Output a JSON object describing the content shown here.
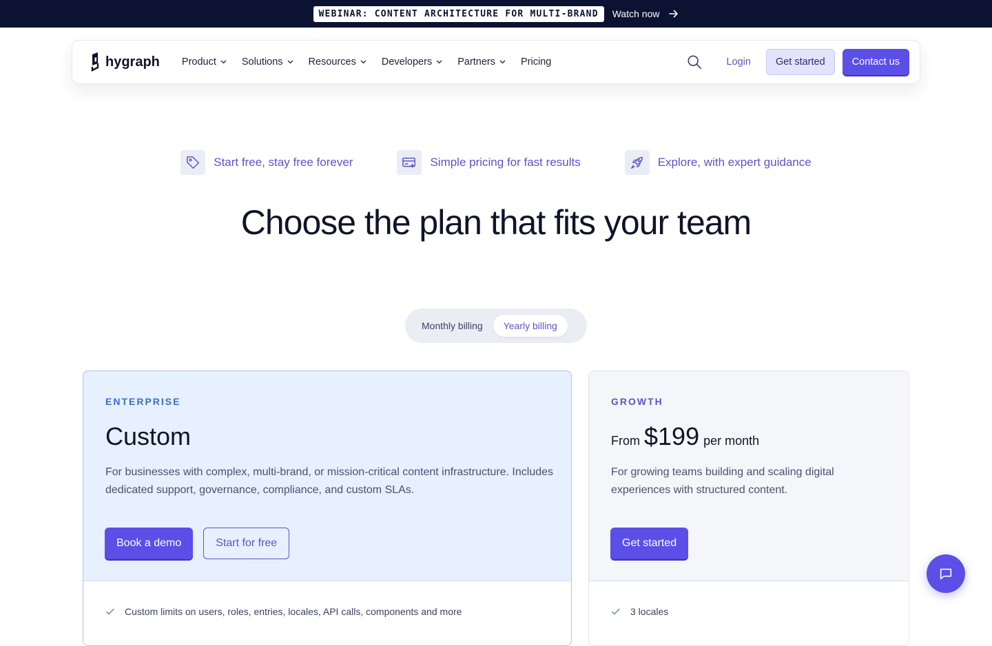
{
  "banner": {
    "tag": "WEBINAR: CONTENT ARCHITECTURE FOR MULTI-BRAND",
    "link": "Watch now",
    "icon": "arrow-right-icon"
  },
  "nav": {
    "logo_text": "hygraph",
    "items": [
      {
        "label": "Product",
        "has_dropdown": true
      },
      {
        "label": "Solutions",
        "has_dropdown": true
      },
      {
        "label": "Resources",
        "has_dropdown": true
      },
      {
        "label": "Developers",
        "has_dropdown": true
      },
      {
        "label": "Partners",
        "has_dropdown": true
      },
      {
        "label": "Pricing",
        "has_dropdown": false
      }
    ],
    "search_icon": "search-icon",
    "login": "Login",
    "get_started": "Get started",
    "contact": "Contact us"
  },
  "features": [
    {
      "icon": "tag-icon",
      "text": "Start free, stay free forever"
    },
    {
      "icon": "card-plus-icon",
      "text": "Simple pricing for fast results"
    },
    {
      "icon": "rocket-icon",
      "text": "Explore, with expert guidance"
    }
  ],
  "headline": "Choose the plan that fits your team",
  "billing": {
    "monthly": "Monthly billing",
    "yearly": "Yearly billing",
    "selected": "yearly"
  },
  "plans": {
    "enterprise": {
      "tier": "ENTERPRISE",
      "title": "Custom",
      "description": "For businesses with complex, multi-brand, or mission-critical content infrastructure. Includes dedicated support, governance, compliance, and custom SLAs.",
      "cta_primary": "Book a demo",
      "cta_secondary": "Start for free",
      "feature_1": "Custom limits on users, roles, entries, locales, API calls, components and more"
    },
    "growth": {
      "tier": "GROWTH",
      "price_prefix": "From",
      "price": "$199",
      "price_suffix": "per month",
      "description": "For growing teams building and scaling digital experiences with structured content.",
      "cta_primary": "Get started",
      "feature_1": "3 locales"
    }
  },
  "chat": {
    "icon": "chat-icon"
  },
  "colors": {
    "brand": "#5b4fe7",
    "banner_bg": "#0c1232",
    "enterprise_bg": "#e6f0fe",
    "growth_bg": "#f5f6f9"
  }
}
